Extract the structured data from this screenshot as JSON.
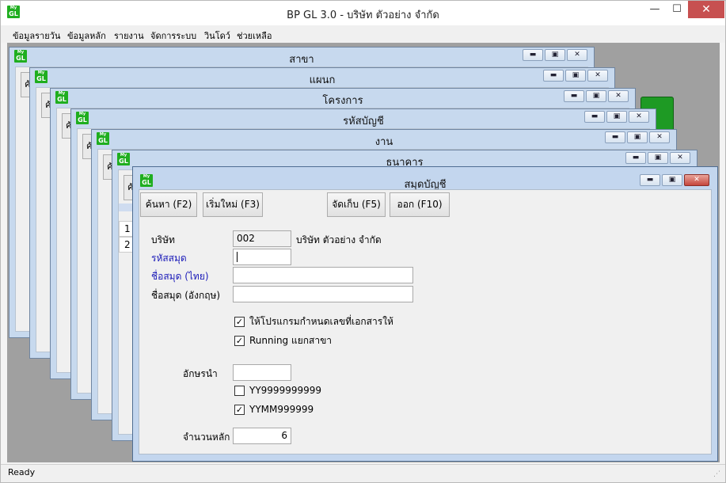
{
  "app": {
    "title": "BP GL 3.0 - บริษัท ตัวอย่าง จำกัด",
    "logo_top": "My",
    "logo_bottom": "GL",
    "min_icon": "—",
    "max_icon": "☐",
    "close_icon": "✕"
  },
  "menu": [
    "ข้อมูลรายวัน",
    "ข้อมูลหลัก",
    "รายงาน",
    "จัดการระบบ",
    "วินโดว์",
    "ช่วยเหลือ"
  ],
  "windows": [
    {
      "title": "สาขา",
      "peek": "ค้"
    },
    {
      "title": "แผนก",
      "peek": "ค้"
    },
    {
      "title": "โครงการ",
      "peek": "ค้"
    },
    {
      "title": "รหัสบัญชี",
      "peek": "ค้"
    },
    {
      "title": "งาน",
      "peek": "ค้"
    },
    {
      "title": "ธนาคาร",
      "peek": "ค้"
    }
  ],
  "peek_rows": [
    "1",
    "2"
  ],
  "child_controls": {
    "min": "▬",
    "max": "▣",
    "close": "✕"
  },
  "dialog": {
    "title": "สมุดบัญชี",
    "buttons": {
      "search": "ค้นหา (F2)",
      "new": "เริ่มใหม่ (F3)",
      "save": "จัดเก็บ (F5)",
      "exit": "ออก (F10)"
    },
    "company_label": "บริษัท",
    "company_code": "002",
    "company_name": "บริษัท ตัวอย่าง จำกัด",
    "book_code_label": "รหัสสมุด",
    "book_code": "",
    "name_th_label": "ชื่อสมุด (ไทย)",
    "name_th": "",
    "name_en_label": "ชื่อสมุด (อังกฤษ)",
    "name_en": "",
    "auto_doc_label": "ให้โปรแกรมกำหนดเลขที่เอกสารให้",
    "auto_doc_checked": true,
    "running_branch_label": "Running แยกสาขา",
    "running_branch_checked": true,
    "prefix_label": "อักษรนำ",
    "prefix": "",
    "fmt1_label": "YY9999999999",
    "fmt1_checked": false,
    "fmt2_label": "YYMM999999",
    "fmt2_checked": true,
    "digits_label": "จำนวนหลัก",
    "digits": "6",
    "check_mark": "✓"
  },
  "status": {
    "text": "Ready",
    "grip": "⋰"
  }
}
